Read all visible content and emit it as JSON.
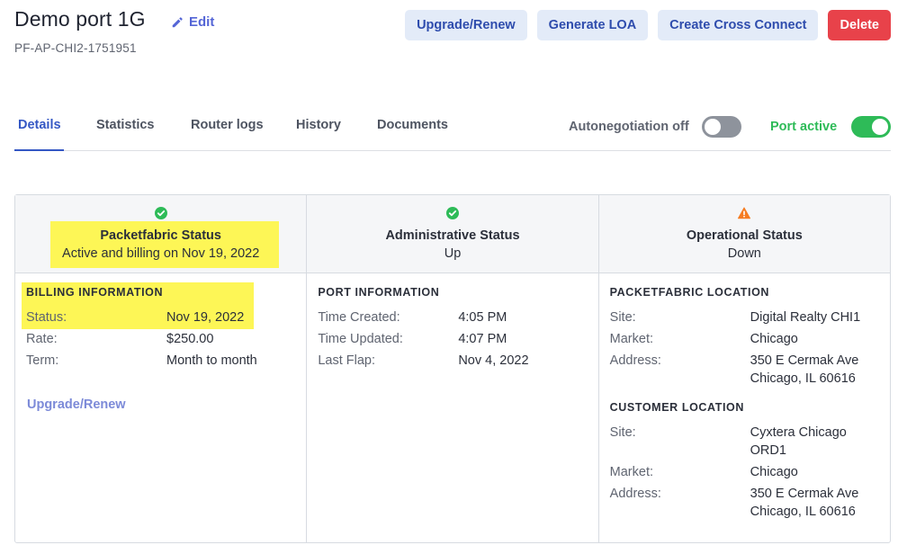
{
  "header": {
    "title": "Demo port 1G",
    "edit_label": "Edit",
    "subtitle": "PF-AP-CHI2-1751951"
  },
  "actions": {
    "upgrade": "Upgrade/Renew",
    "loa": "Generate LOA",
    "cross_connect": "Create Cross Connect",
    "delete": "Delete"
  },
  "tabs": [
    "Details",
    "Statistics",
    "Router logs",
    "History",
    "Documents"
  ],
  "active_tab": "Details",
  "toggles": {
    "autonegotiation": {
      "label": "Autonegotiation off",
      "on": false
    },
    "port_active": {
      "label": "Port active",
      "on": true
    }
  },
  "colors": {
    "accent": "#3457c4",
    "success": "#2ebb58",
    "warning": "#f57c22",
    "danger": "#e8424a",
    "highlight": "#fdf656"
  },
  "statuses": [
    {
      "icon": "check-circle-icon",
      "title": "Packetfabric Status",
      "value": "Active and billing on Nov 19, 2022"
    },
    {
      "icon": "check-circle-icon",
      "title": "Administrative Status",
      "value": "Up"
    },
    {
      "icon": "warning-triangle-icon",
      "title": "Operational Status",
      "value": "Down"
    }
  ],
  "billing": {
    "title": "BILLING INFORMATION",
    "rows": [
      {
        "k": "Status:",
        "v": "Nov 19, 2022"
      },
      {
        "k": "Rate:",
        "v": "$250.00"
      },
      {
        "k": "Term:",
        "v": "Month to month"
      }
    ],
    "link": "Upgrade/Renew"
  },
  "port": {
    "title": "PORT INFORMATION",
    "rows": [
      {
        "k": "Time Created:",
        "v": "4:05 PM"
      },
      {
        "k": "Time Updated:",
        "v": "4:07 PM"
      },
      {
        "k": "Last Flap:",
        "v": "Nov 4, 2022"
      }
    ]
  },
  "pf_location": {
    "title": "PACKETFABRIC LOCATION",
    "rows": [
      {
        "k": "Site:",
        "v": "Digital Realty CHI1"
      },
      {
        "k": "Market:",
        "v": "Chicago"
      },
      {
        "k": "Address:",
        "v1": "350 E Cermak Ave",
        "v2": "Chicago, IL 60616"
      }
    ]
  },
  "customer_location": {
    "title": "CUSTOMER LOCATION",
    "rows": [
      {
        "k": "Site:",
        "v1": "Cyxtera Chicago",
        "v2": "ORD1"
      },
      {
        "k": "Market:",
        "v": "Chicago"
      },
      {
        "k": "Address:",
        "v1": "350 E Cermak Ave",
        "v2": "Chicago, IL 60616"
      }
    ]
  }
}
